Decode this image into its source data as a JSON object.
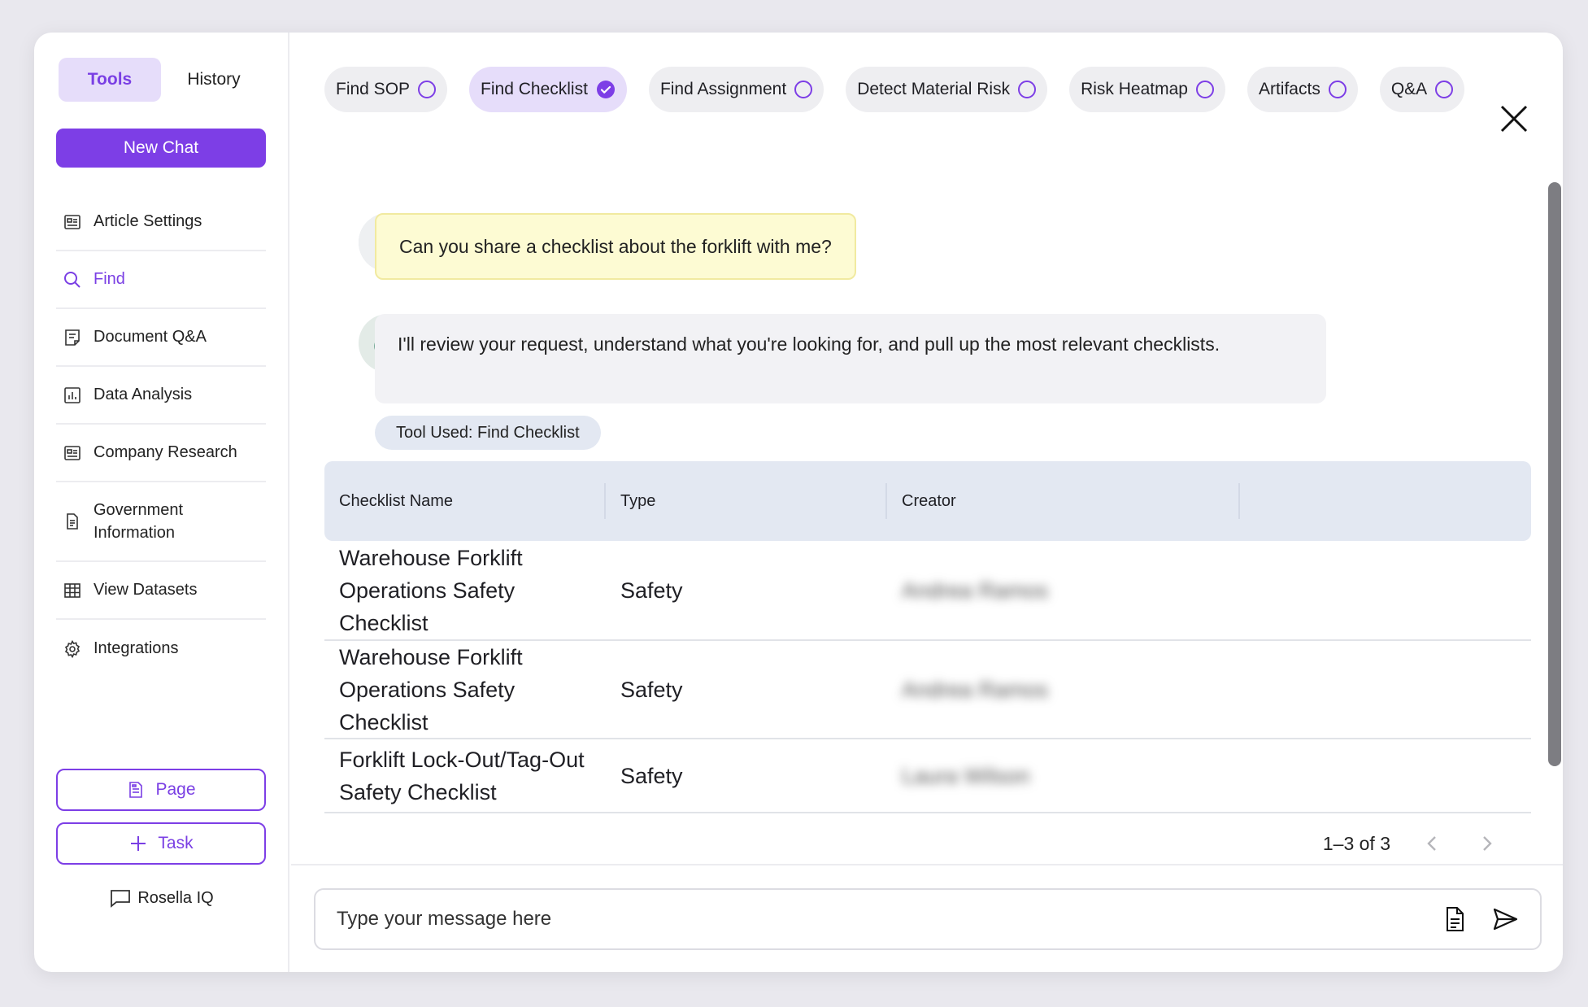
{
  "sidebar": {
    "tabs": [
      {
        "label": "Tools",
        "active": true
      },
      {
        "label": "History",
        "active": false
      }
    ],
    "new_chat_label": "New Chat",
    "menu": [
      {
        "label": "Article Settings",
        "icon": "article-icon"
      },
      {
        "label": "Find",
        "icon": "search-icon",
        "active": true
      },
      {
        "label": "Document Q&A",
        "icon": "document-qa-icon"
      },
      {
        "label": "Data Analysis",
        "icon": "chart-icon"
      },
      {
        "label": "Company Research",
        "icon": "company-icon"
      },
      {
        "label": "Government Information",
        "icon": "file-icon"
      },
      {
        "label": "View Datasets",
        "icon": "table-icon"
      },
      {
        "label": "Integrations",
        "icon": "gear-icon"
      }
    ],
    "page_button_label": "Page",
    "task_button_label": "Task",
    "brand_label": "Rosella IQ"
  },
  "tools": [
    {
      "label": "Find SOP",
      "selected": false
    },
    {
      "label": "Find Checklist",
      "selected": true
    },
    {
      "label": "Find Assignment",
      "selected": false
    },
    {
      "label": "Detect Material Risk",
      "selected": false
    },
    {
      "label": "Risk Heatmap",
      "selected": false
    },
    {
      "label": "Artifacts",
      "selected": false
    },
    {
      "label": "Q&A",
      "selected": false
    }
  ],
  "chat": {
    "user_message": "Can you share a checklist about the forklift with me?",
    "bot_message": "I'll review your request, understand what you're looking for, and pull up the most relevant checklists.",
    "tool_used": "Tool Used: Find Checklist"
  },
  "table": {
    "headers": [
      "Checklist Name",
      "Type",
      "Creator"
    ],
    "rows": [
      {
        "name": "Warehouse Forklift Operations Safety Checklist",
        "type": "Safety",
        "creator": "Andrea Ramos"
      },
      {
        "name": "Warehouse Forklift Operations Safety Checklist",
        "type": "Safety",
        "creator": "Andrea Ramos"
      },
      {
        "name": "Forklift Lock-Out/Tag-Out Safety Checklist",
        "type": "Safety",
        "creator": "Laura Wilson"
      }
    ],
    "pagination": "1–3 of 3"
  },
  "composer": {
    "placeholder": "Type your message here"
  },
  "colors": {
    "accent": "#7d3ee6",
    "accent_light": "#e6ddfa",
    "user_bubble": "#fdfbd3",
    "table_header": "#e3e8f2"
  }
}
